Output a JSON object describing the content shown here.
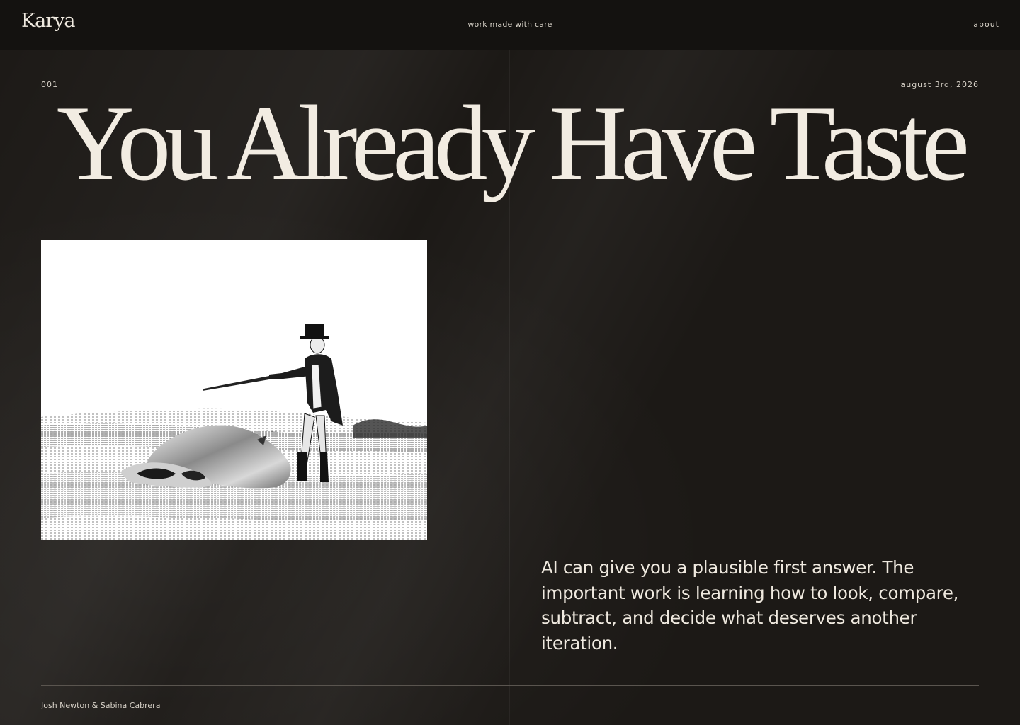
{
  "header": {
    "logo": "Karya",
    "tagline": "work made with care",
    "about_label": "about"
  },
  "article": {
    "issue_number": "001",
    "date": "august 3rd, 2026",
    "title": "You Already Have Taste",
    "intro": "AI can give you a plausible first answer. The important work is learning how to look, compare, subtract, and decide what deserves another iteration."
  },
  "footer": {
    "credits": "Josh Newton & Sabina Cabrera"
  },
  "colors": {
    "background": "#1b1816",
    "header_background": "#141210",
    "text": "#efe9df",
    "image_background": "#ffffff"
  }
}
